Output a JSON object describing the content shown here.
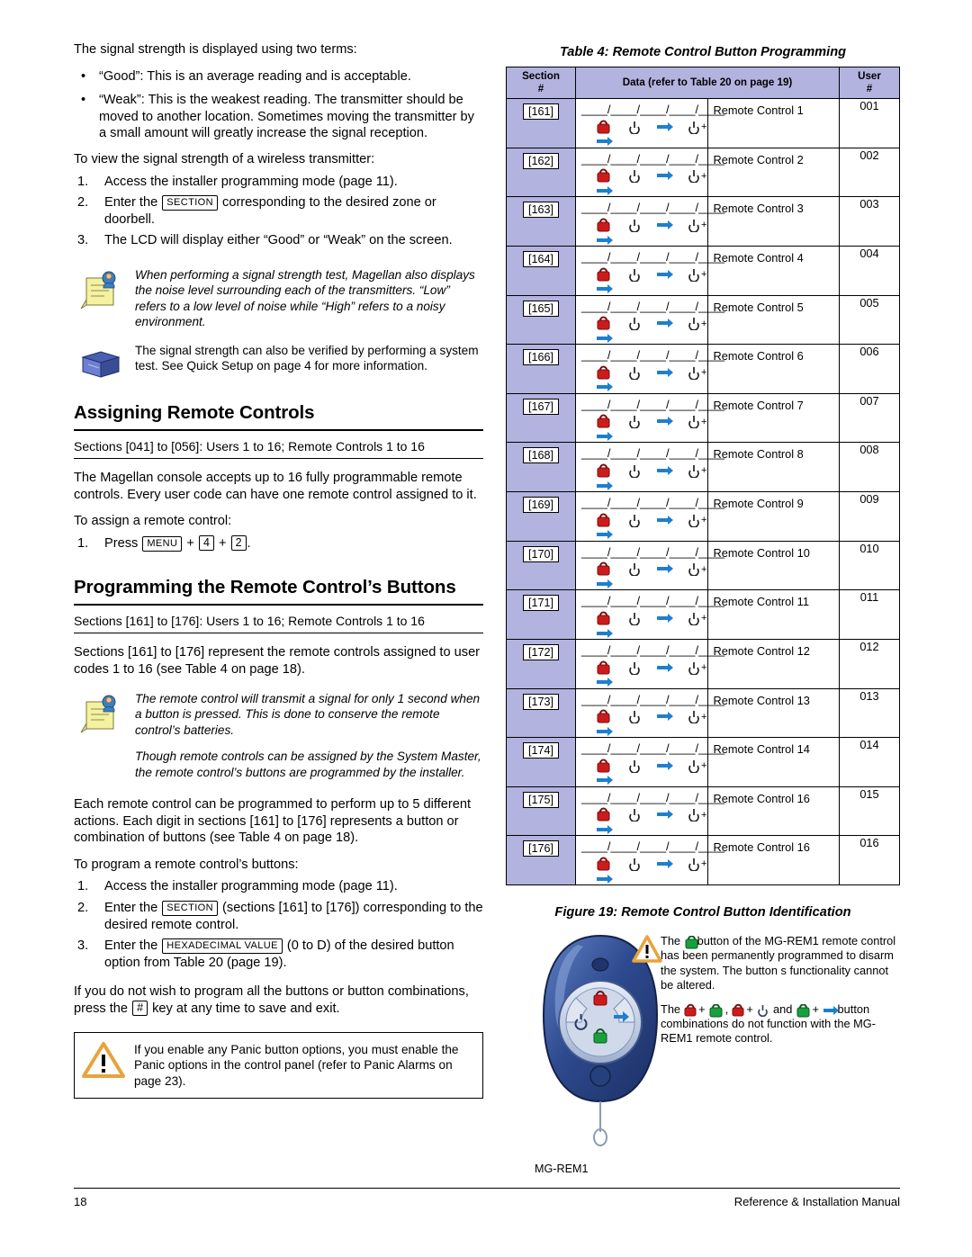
{
  "left": {
    "intro": "The signal strength is displayed using two terms:",
    "bullets": [
      "“Good”: This is an average reading and is acceptable.",
      "“Weak”: This is the weakest reading. The transmitter should be moved to another location. Sometimes moving the transmitter by a small amount will greatly increase the signal reception."
    ],
    "view_lead": "To view the signal strength of a wireless transmitter:",
    "view_steps": [
      "Access the installer programming mode (page 11).",
      "Enter the [SECTION] corresponding to the desired zone or doorbell.",
      "The LCD will display either “Good” or “Weak” on the screen."
    ],
    "step2_pre": "Enter the ",
    "step2_kbd": "SECTION",
    "step2_post": " corresponding to the desired zone or doorbell.",
    "note1": "When performing a signal strength test, Magellan also displays the noise level surrounding each of the transmitters. “Low” refers to a low level of noise while “High” refers to a noisy environment.",
    "note2": "The signal strength can also be verified by performing a system test. See Quick Setup on page 4 for more information.",
    "head1": "Assigning Remote Controls",
    "head1_sub": "Sections [041] to [056]: Users 1 to 16; Remote Controls 1 to 16",
    "para1": "The Magellan console accepts up to 16 fully programmable remote controls. Every user code can have one remote control assigned to it.",
    "assign_lead": "To assign a remote control:",
    "assign_step_pre": "Press ",
    "assign_kbd1": "MENU",
    "assign_plus": " + ",
    "assign_kbd2": "4",
    "assign_kbd3": "2",
    "assign_step_post": ".",
    "head2": "Programming the Remote Control’s Buttons",
    "head2_sub": "Sections [161] to [176]: Users 1 to 16; Remote Controls 1 to 16",
    "para2": "Sections [161] to [176] represent the remote controls assigned to user codes 1 to 16 (see Table 4 on page 18).",
    "note3": "The remote control will transmit a signal for only 1 second when a button is pressed. This is done to conserve the remote control’s batteries.",
    "note4": "Though remote controls can be assigned by the System Master, the remote control’s buttons are programmed by the installer.",
    "para3": "Each remote control can be programmed to perform up to 5 different actions. Each digit in sections [161] to [176] represents a button or combination of buttons (see Table 4 on page 18).",
    "prog_lead": "To program a remote control’s buttons:",
    "prog_steps": [
      "Access the installer programming mode (page 11).",
      "Enter the [SECTION] (sections [161] to [176]) corresponding to the desired remote control.",
      "Enter the [HEXADECIMAL VALUE] (0 to D) of the desired button option from Table 20 (page 19)."
    ],
    "prog2_pre": "Enter the ",
    "prog2_kbd": "SECTION",
    "prog2_post": " (sections [161] to [176]) corresponding to the desired remote control.",
    "prog3_pre": "Enter the ",
    "prog3_kbd": "HEXADECIMAL VALUE",
    "prog3_post": " (0 to D) of the desired button option from Table 20 (page 19).",
    "para4_pre": "If you do not wish to program all the buttons or button combinations, press the ",
    "para4_kbd": "#",
    "para4_post": " key at any time to save and exit.",
    "warn": "If you enable any Panic button options, you must enable the Panic options in the control panel (refer to Panic Alarms on page 23)."
  },
  "table": {
    "caption": "Table  4: Remote Control Button Programming",
    "headers": {
      "section": "Section",
      "section_sub": "#",
      "data": "Data (refer to Table 20 on page 19)",
      "user": "User",
      "user_sub": "#"
    },
    "blank_lines": "____/____/____/____/____",
    "rows": [
      {
        "section": "[161]",
        "name": "Remote Control 1",
        "user": "001"
      },
      {
        "section": "[162]",
        "name": "Remote Control 2",
        "user": "002"
      },
      {
        "section": "[163]",
        "name": "Remote Control 3",
        "user": "003"
      },
      {
        "section": "[164]",
        "name": "Remote Control 4",
        "user": "004"
      },
      {
        "section": "[165]",
        "name": "Remote Control 5",
        "user": "005"
      },
      {
        "section": "[166]",
        "name": "Remote Control 6",
        "user": "006"
      },
      {
        "section": "[167]",
        "name": "Remote Control 7",
        "user": "007"
      },
      {
        "section": "[168]",
        "name": "Remote Control 8",
        "user": "008"
      },
      {
        "section": "[169]",
        "name": "Remote Control 9",
        "user": "009"
      },
      {
        "section": "[170]",
        "name": "Remote Control 10",
        "user": "010"
      },
      {
        "section": "[171]",
        "name": "Remote Control 11",
        "user": "011"
      },
      {
        "section": "[172]",
        "name": "Remote Control 12",
        "user": "012"
      },
      {
        "section": "[173]",
        "name": "Remote Control 13",
        "user": "013"
      },
      {
        "section": "[174]",
        "name": "Remote Control 14",
        "user": "014"
      },
      {
        "section": "[175]",
        "name": "Remote Control 16",
        "user": "015"
      },
      {
        "section": "[176]",
        "name": "Remote Control 16",
        "user": "016"
      }
    ]
  },
  "figure": {
    "caption": "Figure  19: Remote Control Button Identification",
    "device_label": "MG-REM1",
    "text1_pre": "The ",
    "text1_post": "button of the MG-REM1 remote control has been permanently programmed to disarm the system. The button s functionality cannot be altered.",
    "text2_pre": "The ",
    "text2_mid1": " + ",
    "text2_mid2": " , ",
    "text2_mid3": " + ",
    "text2_mid4": " and ",
    "text2_mid5": " + ",
    "text2_post": "button combinations do not function with the MG-REM1 remote control."
  },
  "footer": {
    "page": "18",
    "manual": "Reference & Installation Manual"
  },
  "colors": {
    "header_bg": "#b3b3e0",
    "lock_red": "#c00000",
    "green": "#1a9641",
    "remote_blue": "#2f4f8f"
  }
}
